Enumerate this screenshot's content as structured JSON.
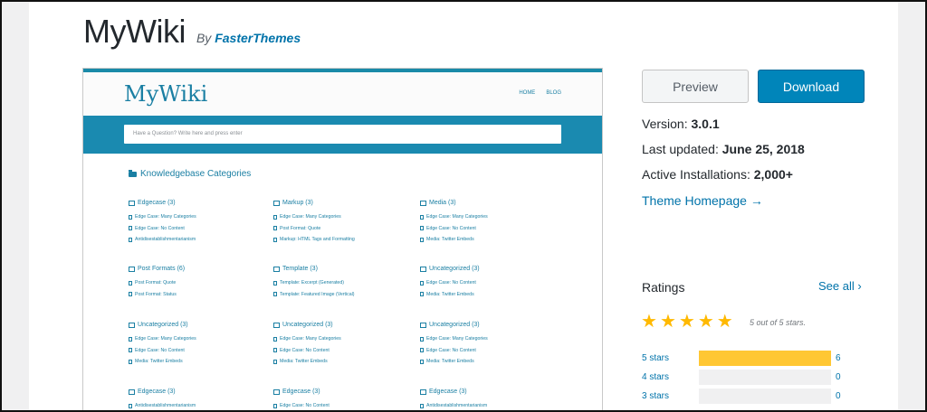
{
  "theme": {
    "name": "MyWiki",
    "by_prefix": "By",
    "author": "FasterThemes"
  },
  "preview_screenshot": {
    "logo": "MyWiki",
    "nav": [
      "HOME",
      "BLOG"
    ],
    "search_placeholder": "Have a Question? Write here and press enter",
    "kb_title": "Knowledgebase Categories",
    "categories": [
      {
        "title": "Edgecase (3)",
        "items": [
          "Edge Case: Many Categories",
          "Edge Case: No Content",
          "Antidisestablishmentarianism"
        ]
      },
      {
        "title": "Markup (3)",
        "items": [
          "Edge Case: Many Categories",
          "Post Format: Quote",
          "Markup: HTML Tags and Formatting"
        ]
      },
      {
        "title": "Media (3)",
        "items": [
          "Edge Case: Many Categories",
          "Edge Case: No Content",
          "Media: Twitter Embeds"
        ]
      },
      {
        "title": "Post Formats (6)",
        "items": [
          "Post Format: Quote",
          "Post Format: Status"
        ]
      },
      {
        "title": "Template (3)",
        "items": [
          "Template: Excerpt (Generated)",
          "Template: Featured Image (Vertical)"
        ]
      },
      {
        "title": "Uncategorized (3)",
        "items": [
          "Edge Case: No Content",
          "Media: Twitter Embeds"
        ]
      },
      {
        "title": "Uncategorized (3)",
        "items": [
          "Edge Case: Many Categories",
          "Edge Case: No Content",
          "Media: Twitter Embeds"
        ]
      },
      {
        "title": "Uncategorized (3)",
        "items": [
          "Edge Case: Many Categories",
          "Edge Case: No Content",
          "Media: Twitter Embeds"
        ]
      },
      {
        "title": "Uncategorized (3)",
        "items": [
          "Edge Case: Many Categories",
          "Edge Case: No Content",
          "Media: Twitter Embeds"
        ]
      },
      {
        "title": "Edgecase (3)",
        "items": [
          "Antidisestablishmentarianism"
        ]
      },
      {
        "title": "Edgecase (3)",
        "items": [
          "Edge Case: No Content"
        ]
      },
      {
        "title": "Edgecase (3)",
        "items": [
          "Antidisestablishmentarianism"
        ]
      }
    ]
  },
  "actions": {
    "preview_label": "Preview",
    "download_label": "Download"
  },
  "meta": {
    "version_label": "Version:",
    "version": "3.0.1",
    "updated_label": "Last updated:",
    "updated": "June 25, 2018",
    "installs_label": "Active Installations:",
    "installs": "2,000+",
    "homepage_link": "Theme Homepage →"
  },
  "ratings": {
    "title": "Ratings",
    "see_all": "See all ›",
    "stars_value": 5,
    "stars_text": "5 out of 5 stars.",
    "rows": [
      {
        "label": "5 stars",
        "count": "6",
        "fraction": 1.0
      },
      {
        "label": "4 stars",
        "count": "0",
        "fraction": 0
      },
      {
        "label": "3 stars",
        "count": "0",
        "fraction": 0
      }
    ]
  },
  "colors": {
    "accent": "#0073aa",
    "download": "#0085ba",
    "star": "#ffb900",
    "bar_fill": "#ffc733",
    "preview_teal": "#1a8ab0"
  }
}
